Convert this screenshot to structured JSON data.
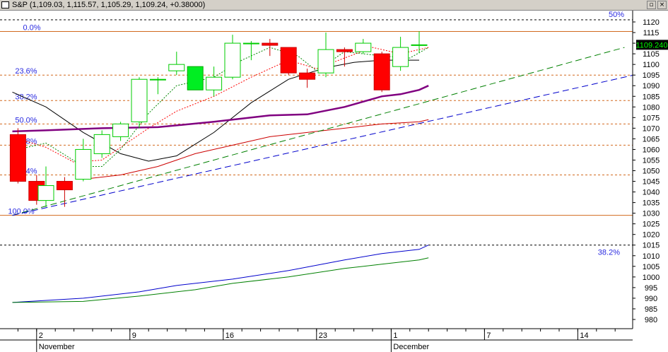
{
  "window": {
    "title": "S&P (1,109.03, 1,115.57, 1,105.29, 1,109.24, +0.38000)",
    "restore_icon": "restore-icon",
    "close_icon": "close-icon",
    "restore_glyph": "▫",
    "close_glyph": "×"
  },
  "chart_data": {
    "type": "candlestick",
    "title": "S&P (1,109.03, 1,115.57, 1,105.29, 1,109.24, +0.38000)",
    "ylim": [
      977,
      1124
    ],
    "y_ticks": [
      980,
      985,
      990,
      995,
      1000,
      1005,
      1010,
      1015,
      1020,
      1025,
      1030,
      1035,
      1040,
      1045,
      1050,
      1055,
      1060,
      1065,
      1070,
      1075,
      1080,
      1085,
      1090,
      1095,
      1100,
      1105,
      1110,
      1115,
      1120
    ],
    "x_ticks": [
      {
        "label": "2",
        "session": 0
      },
      {
        "label": "9",
        "session": 5
      },
      {
        "label": "16",
        "session": 10
      },
      {
        "label": "23",
        "session": 15
      },
      {
        "label": "1",
        "session": 19
      },
      {
        "label": "7",
        "session": 24
      },
      {
        "label": "14",
        "session": 29
      }
    ],
    "months": [
      {
        "label": "November",
        "session": 0
      },
      {
        "label": "December",
        "session": 19
      }
    ],
    "last_price_label": "1109.240",
    "last_price": 1109.24,
    "candles": [
      {
        "i": -1.5,
        "o": 1067,
        "h": 1070,
        "l": 1044,
        "c": 1045
      },
      {
        "i": -0.5,
        "o": 1045,
        "h": 1048,
        "l": 1034,
        "c": 1036
      },
      {
        "i": 0,
        "o": 1036,
        "h": 1052,
        "l": 1033,
        "c": 1043
      },
      {
        "i": 1,
        "o": 1045,
        "h": 1047,
        "l": 1033,
        "c": 1041
      },
      {
        "i": 2,
        "o": 1046,
        "h": 1065,
        "l": 1045,
        "c": 1060
      },
      {
        "i": 3,
        "o": 1058,
        "h": 1069,
        "l": 1056,
        "c": 1067
      },
      {
        "i": 4,
        "o": 1066,
        "h": 1073,
        "l": 1064,
        "c": 1072
      },
      {
        "i": 5,
        "o": 1073,
        "h": 1094,
        "l": 1070,
        "c": 1093
      },
      {
        "i": 6,
        "o": 1093,
        "h": 1094,
        "l": 1086,
        "c": 1093
      },
      {
        "i": 7,
        "o": 1097,
        "h": 1106,
        "l": 1095,
        "c": 1100
      },
      {
        "i": 8,
        "o": 1099,
        "h": 1099,
        "l": 1088,
        "c": 1088
      },
      {
        "i": 9,
        "o": 1088,
        "h": 1099,
        "l": 1085,
        "c": 1094
      },
      {
        "i": 10,
        "o": 1094,
        "h": 1114,
        "l": 1093,
        "c": 1110
      },
      {
        "i": 11,
        "o": 1110,
        "h": 1111,
        "l": 1102,
        "c": 1110
      },
      {
        "i": 12,
        "o": 1110,
        "h": 1112,
        "l": 1104,
        "c": 1109
      },
      {
        "i": 13,
        "o": 1108,
        "h": 1108,
        "l": 1095,
        "c": 1096
      },
      {
        "i": 14,
        "o": 1096,
        "h": 1098,
        "l": 1089,
        "c": 1093
      },
      {
        "i": 15,
        "o": 1096,
        "h": 1115,
        "l": 1094,
        "c": 1107
      },
      {
        "i": 16,
        "o": 1107,
        "h": 1108,
        "l": 1099,
        "c": 1106
      },
      {
        "i": 17,
        "o": 1106,
        "h": 1112,
        "l": 1105,
        "c": 1110
      },
      {
        "i": 18,
        "o": 1105,
        "h": 1106,
        "l": 1087,
        "c": 1088
      },
      {
        "i": 19,
        "o": 1099,
        "h": 1113,
        "l": 1097,
        "c": 1108
      },
      {
        "i": 20,
        "o": 1109.03,
        "h": 1115.57,
        "l": 1105.29,
        "c": 1109.24
      }
    ],
    "lines": {
      "sma_black": {
        "color": "#000000",
        "points": [
          [
            -1.8,
            1087
          ],
          [
            0,
            1080
          ],
          [
            2,
            1068
          ],
          [
            4,
            1058
          ],
          [
            5.5,
            1054.5
          ],
          [
            7,
            1057
          ],
          [
            9,
            1068
          ],
          [
            11,
            1082
          ],
          [
            13,
            1093
          ],
          [
            15,
            1098.5
          ],
          [
            16.5,
            1101
          ],
          [
            18,
            1102
          ],
          [
            20,
            1102
          ]
        ]
      },
      "ema_red_dotted": {
        "color": "#ff0000",
        "points": [
          [
            -1.5,
            1065
          ],
          [
            0,
            1061
          ],
          [
            1.5,
            1054
          ],
          [
            3,
            1055
          ],
          [
            4,
            1061
          ],
          [
            5.5,
            1070
          ],
          [
            7,
            1078
          ],
          [
            9,
            1085
          ],
          [
            11,
            1094
          ],
          [
            13,
            1102
          ],
          [
            14.5,
            1098
          ],
          [
            16,
            1103
          ],
          [
            17.5,
            1108
          ],
          [
            19,
            1105
          ],
          [
            20.5,
            1108
          ]
        ]
      },
      "green_dotted": {
        "color": "#008800",
        "points": [
          [
            -1.5,
            1060
          ],
          [
            0,
            1063
          ],
          [
            2,
            1052
          ],
          [
            3,
            1052
          ],
          [
            4,
            1060
          ],
          [
            5.5,
            1077
          ],
          [
            7,
            1090
          ],
          [
            9,
            1094
          ],
          [
            10.5,
            1102
          ],
          [
            12,
            1108
          ],
          [
            13.5,
            1104
          ],
          [
            14.5,
            1097
          ],
          [
            16,
            1106
          ],
          [
            18,
            1104
          ],
          [
            19.5,
            1103
          ],
          [
            20.5,
            1108
          ]
        ]
      },
      "purple_ma": {
        "color": "#800080",
        "points": [
          [
            -1.8,
            1068.5
          ],
          [
            0,
            1069
          ],
          [
            3,
            1070
          ],
          [
            6,
            1070.5
          ],
          [
            9,
            1073
          ],
          [
            12,
            1076
          ],
          [
            14,
            1076.5
          ],
          [
            16,
            1080
          ],
          [
            18,
            1085
          ],
          [
            19,
            1086
          ],
          [
            20,
            1088
          ],
          [
            20.5,
            1090
          ]
        ]
      },
      "red_ma": {
        "color": "#cc0000",
        "points": [
          [
            2,
            1046
          ],
          [
            4,
            1048
          ],
          [
            6,
            1052
          ],
          [
            8,
            1058
          ],
          [
            10,
            1062
          ],
          [
            12,
            1066
          ],
          [
            14,
            1068
          ],
          [
            16,
            1070
          ],
          [
            18,
            1072
          ],
          [
            20,
            1073
          ],
          [
            20.5,
            1074
          ]
        ]
      },
      "trend_green_dashed": {
        "color": "#008000",
        "dashed": true,
        "points": [
          [
            -1.8,
            1029
          ],
          [
            31,
            1108
          ]
        ]
      },
      "trend_blue_dashed": {
        "color": "#0000cc",
        "dashed": true,
        "points": [
          [
            -1.8,
            1029
          ],
          [
            33,
            1098
          ]
        ]
      },
      "blue_lower": {
        "color": "#0000cc",
        "points": [
          [
            -1.8,
            988
          ],
          [
            2,
            990
          ],
          [
            5,
            993
          ],
          [
            7,
            996
          ],
          [
            10,
            999
          ],
          [
            13,
            1003
          ],
          [
            16,
            1008
          ],
          [
            18,
            1011
          ],
          [
            20,
            1013
          ],
          [
            20.5,
            1015
          ]
        ]
      },
      "green_lower": {
        "color": "#008000",
        "points": [
          [
            -1.8,
            988
          ],
          [
            2,
            988.5
          ],
          [
            5,
            991
          ],
          [
            8,
            994
          ],
          [
            10,
            997
          ],
          [
            13,
            1000
          ],
          [
            16,
            1004
          ],
          [
            18,
            1006
          ],
          [
            20,
            1008
          ],
          [
            20.5,
            1009
          ]
        ]
      }
    },
    "fibonacci": {
      "color": "#d2691e",
      "levels": [
        {
          "label": "0.0%",
          "value": 1115.5,
          "solid": true
        },
        {
          "label": "23.6%",
          "value": 1095
        },
        {
          "label": "38.2%",
          "value": 1083
        },
        {
          "label": "50.0%",
          "value": 1072
        },
        {
          "label": "61.8%",
          "value": 1062
        },
        {
          "label": "76.4%",
          "value": 1048
        },
        {
          "label": "100.0%",
          "value": 1029,
          "solid": true
        }
      ]
    },
    "black_dashed_levels": [
      {
        "value": 1121,
        "label": "50%"
      },
      {
        "value": 1015,
        "label": "38.2%"
      }
    ]
  }
}
